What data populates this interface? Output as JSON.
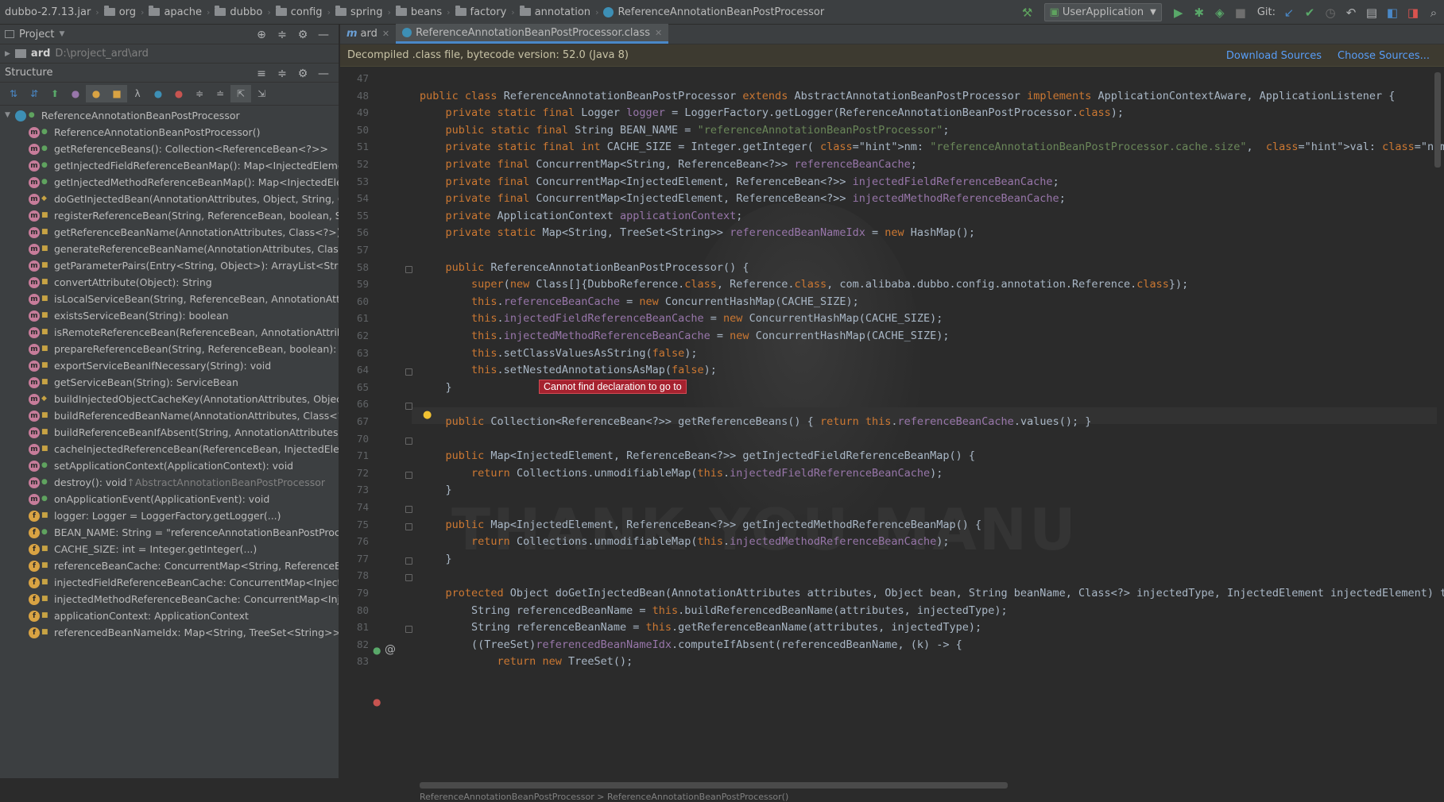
{
  "nav": {
    "crumbs": [
      "dubbo-2.7.13.jar",
      "org",
      "apache",
      "dubbo",
      "config",
      "spring",
      "beans",
      "factory",
      "annotation",
      "ReferenceAnnotationBeanPostProcessor"
    ],
    "run_config": "UserApplication",
    "git_label": "Git:"
  },
  "project_panel": {
    "title": "Project",
    "root_name": "ard",
    "root_path": "D:\\project_ard\\ard"
  },
  "structure_panel": {
    "title": "Structure",
    "root": "ReferenceAnnotationBeanPostProcessor",
    "items": [
      {
        "kind": "m",
        "vis": "pub",
        "text": "ReferenceAnnotationBeanPostProcessor()",
        "inherited": ""
      },
      {
        "kind": "m",
        "vis": "pub",
        "text": "getReferenceBeans(): Collection<ReferenceBean<?>>",
        "inherited": ""
      },
      {
        "kind": "m",
        "vis": "pub",
        "text": "getInjectedFieldReferenceBeanMap(): Map<InjectedElement,",
        "inherited": ""
      },
      {
        "kind": "m",
        "vis": "pub",
        "text": "getInjectedMethodReferenceBeanMap(): Map<InjectedEleme",
        "inherited": ""
      },
      {
        "kind": "m",
        "vis": "prot",
        "text": "doGetInjectedBean(AnnotationAttributes, Object, String, Class",
        "inherited": ""
      },
      {
        "kind": "m",
        "vis": "priv",
        "text": "registerReferenceBean(String, ReferenceBean, boolean, String",
        "inherited": ""
      },
      {
        "kind": "m",
        "vis": "priv",
        "text": "getReferenceBeanName(AnnotationAttributes, Class<?>): Stri",
        "inherited": ""
      },
      {
        "kind": "m",
        "vis": "priv",
        "text": "generateReferenceBeanName(AnnotationAttributes, Class<?>",
        "inherited": ""
      },
      {
        "kind": "m",
        "vis": "priv",
        "text": "getParameterPairs(Entry<String, Object>): ArrayList<String>",
        "inherited": ""
      },
      {
        "kind": "m",
        "vis": "priv",
        "text": "convertAttribute(Object): String",
        "inherited": ""
      },
      {
        "kind": "m",
        "vis": "priv",
        "text": "isLocalServiceBean(String, ReferenceBean, AnnotationAttribut",
        "inherited": ""
      },
      {
        "kind": "m",
        "vis": "priv",
        "text": "existsServiceBean(String): boolean",
        "inherited": ""
      },
      {
        "kind": "m",
        "vis": "priv",
        "text": "isRemoteReferenceBean(ReferenceBean, AnnotationAttributes",
        "inherited": ""
      },
      {
        "kind": "m",
        "vis": "priv",
        "text": "prepareReferenceBean(String, ReferenceBean, boolean): void",
        "inherited": ""
      },
      {
        "kind": "m",
        "vis": "priv",
        "text": "exportServiceBeanIfNecessary(String): void",
        "inherited": ""
      },
      {
        "kind": "m",
        "vis": "priv",
        "text": "getServiceBean(String): ServiceBean",
        "inherited": ""
      },
      {
        "kind": "m",
        "vis": "prot",
        "text": "buildInjectedObjectCacheKey(AnnotationAttributes, Object, St",
        "inherited": ""
      },
      {
        "kind": "m",
        "vis": "priv",
        "text": "buildReferencedBeanName(AnnotationAttributes, Class<?>):",
        "inherited": ""
      },
      {
        "kind": "m",
        "vis": "priv",
        "text": "buildReferenceBeanIfAbsent(String, AnnotationAttributes, Cla",
        "inherited": ""
      },
      {
        "kind": "m",
        "vis": "priv",
        "text": "cacheInjectedReferenceBean(ReferenceBean, InjectedElement",
        "inherited": ""
      },
      {
        "kind": "m",
        "vis": "pub",
        "text": "setApplicationContext(ApplicationContext): void",
        "inherited": ""
      },
      {
        "kind": "m",
        "vis": "pub",
        "text": "destroy(): void ",
        "inherited": "↑AbstractAnnotationBeanPostProcessor"
      },
      {
        "kind": "m",
        "vis": "pub",
        "text": "onApplicationEvent(ApplicationEvent): void",
        "inherited": ""
      },
      {
        "kind": "f",
        "vis": "priv",
        "text": "logger: Logger = LoggerFactory.getLogger(...)",
        "inherited": ""
      },
      {
        "kind": "f",
        "vis": "pub",
        "text": "BEAN_NAME: String = \"referenceAnnotationBeanPostProcess",
        "inherited": ""
      },
      {
        "kind": "f",
        "vis": "priv",
        "text": "CACHE_SIZE: int = Integer.getInteger(...)",
        "inherited": ""
      },
      {
        "kind": "f",
        "vis": "priv",
        "text": "referenceBeanCache: ConcurrentMap<String, ReferenceBean",
        "inherited": ""
      },
      {
        "kind": "f",
        "vis": "priv",
        "text": "injectedFieldReferenceBeanCache: ConcurrentMap<InjectedE",
        "inherited": ""
      },
      {
        "kind": "f",
        "vis": "priv",
        "text": "injectedMethodReferenceBeanCache: ConcurrentMap<Injecte",
        "inherited": ""
      },
      {
        "kind": "f",
        "vis": "priv",
        "text": "applicationContext: ApplicationContext",
        "inherited": ""
      },
      {
        "kind": "f",
        "vis": "priv",
        "text": "referencedBeanNameIdx: Map<String, TreeSet<String>> = n",
        "inherited": ""
      }
    ]
  },
  "tabs": [
    {
      "label": "ard",
      "active": false
    },
    {
      "label": "ReferenceAnnotationBeanPostProcessor.class",
      "active": true
    }
  ],
  "banner": {
    "text": "Decompiled .class file, bytecode version: 52.0 (Java 8)",
    "download": "Download Sources",
    "choose": "Choose Sources..."
  },
  "editor": {
    "tooltip": "Cannot find declaration to go to",
    "watermark": "THANK YOU MANU",
    "status_crumbs": "ReferenceAnnotationBeanPostProcessor  >  ReferenceAnnotationBeanPostProcessor()",
    "line_numbers": [
      "47",
      "48",
      "49",
      "50",
      "51",
      "52",
      "53",
      "54",
      "55",
      "56",
      "57",
      "58",
      "59",
      "60",
      "61",
      "62",
      "63",
      "64",
      "65",
      "66",
      "67",
      "70",
      "71",
      "72",
      "73",
      "74",
      "75",
      "76",
      "77",
      "78",
      "79",
      "80",
      "81",
      "82",
      "83"
    ],
    "lines": [
      "",
      "public class ReferenceAnnotationBeanPostProcessor extends AbstractAnnotationBeanPostProcessor implements ApplicationContextAware, ApplicationListener {",
      "    private static final Logger logger = LoggerFactory.getLogger(ReferenceAnnotationBeanPostProcessor.class);",
      "    public static final String BEAN_NAME = \"referenceAnnotationBeanPostProcessor\";",
      "    private static final int CACHE_SIZE = Integer.getInteger( nm: \"referenceAnnotationBeanPostProcessor.cache.size\",  val: 32);",
      "    private final ConcurrentMap<String, ReferenceBean<?>> referenceBeanCache;",
      "    private final ConcurrentMap<InjectedElement, ReferenceBean<?>> injectedFieldReferenceBeanCache;",
      "    private final ConcurrentMap<InjectedElement, ReferenceBean<?>> injectedMethodReferenceBeanCache;",
      "    private ApplicationContext applicationContext;",
      "    private static Map<String, TreeSet<String>> referencedBeanNameIdx = new HashMap();",
      "",
      "    public ReferenceAnnotationBeanPostProcessor() {",
      "        super(new Class[]{DubboReference.class, Reference.class, com.alibaba.dubbo.config.annotation.Reference.class});",
      "        this.referenceBeanCache = new ConcurrentHashMap(CACHE_SIZE);",
      "        this.injectedFieldReferenceBeanCache = new ConcurrentHashMap(CACHE_SIZE);",
      "        this.injectedMethodReferenceBeanCache = new ConcurrentHashMap(CACHE_SIZE);",
      "        this.setClassValuesAsString(false);",
      "        this.setNestedAnnotationsAsMap(false);",
      "    }",
      "",
      "    public Collection<ReferenceBean<?>> getReferenceBeans() { return this.referenceBeanCache.values(); }",
      "",
      "    public Map<InjectedElement, ReferenceBean<?>> getInjectedFieldReferenceBeanMap() {",
      "        return Collections.unmodifiableMap(this.injectedFieldReferenceBeanCache);",
      "    }",
      "",
      "    public Map<InjectedElement, ReferenceBean<?>> getInjectedMethodReferenceBeanMap() {",
      "        return Collections.unmodifiableMap(this.injectedMethodReferenceBeanCache);",
      "    }",
      "",
      "    protected Object doGetInjectedBean(AnnotationAttributes attributes, Object bean, String beanName, Class<?> injectedType, InjectedElement injectedElement) thr",
      "        String referencedBeanName = this.buildReferencedBeanName(attributes, injectedType);",
      "        String referenceBeanName = this.getReferenceBeanName(attributes, injectedType);",
      "        ((TreeSet)referencedBeanNameIdx.computeIfAbsent(referencedBeanName, (k) -> {",
      "            return new TreeSet();"
    ]
  },
  "colors": {
    "keyword": "#cc7832",
    "string": "#6a8759",
    "number": "#6897bb",
    "field": "#9876aa",
    "text": "#a9b7c6",
    "tooltip_bg": "#a6222f"
  }
}
